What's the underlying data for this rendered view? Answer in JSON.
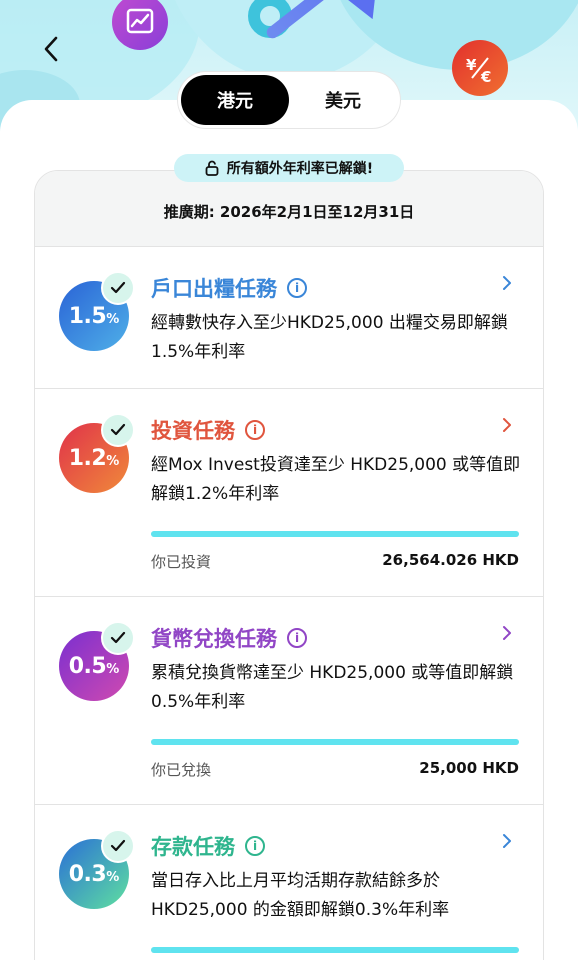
{
  "header": {
    "currency_tabs": [
      {
        "label": "港元",
        "active": true
      },
      {
        "label": "美元",
        "active": false
      }
    ]
  },
  "unlock_banner": "所有額外年利率已解鎖!",
  "promo_period": "推廣期: 2026年2月1日至12月31日",
  "tasks": [
    {
      "rate_number": "1.5",
      "rate_unit": "%",
      "title": "戶口出糧任務",
      "description": "經轉數快存入至少HKD25,000 出糧交易即解鎖1.5%年利率",
      "completed": true
    },
    {
      "rate_number": "1.2",
      "rate_unit": "%",
      "title": "投資任務",
      "description": "經Mox Invest投資達至少 HKD25,000 或等值即解鎖1.2%年利率",
      "completed": true,
      "progress": 1.0,
      "foot_label": "你已投資",
      "foot_value": "26,564.026 HKD"
    },
    {
      "rate_number": "0.5",
      "rate_unit": "%",
      "title": "貨幣兌換任務",
      "description": "累積兌換貨幣達至少 HKD25,000 或等值即解鎖0.5%年利率",
      "completed": true,
      "progress": 1.0,
      "foot_label": "你已兌換",
      "foot_value": "25,000 HKD"
    },
    {
      "rate_number": "0.3",
      "rate_unit": "%",
      "title": "存款任務",
      "description": "當日存入比上月平均活期存款結餘多於HKD25,000 的金額即解鎖0.3%年利率",
      "completed": true,
      "progress": 1.0
    }
  ],
  "icons": {
    "back": "chevron-left-icon",
    "lock": "unlock-icon",
    "info": "info-icon",
    "chevron": "chevron-right-icon",
    "check": "check-icon",
    "fx": "currency-exchange-icon",
    "chart": "trend-chart-icon"
  },
  "colors": {
    "task1": "#3a86d8",
    "task2": "#e0553e",
    "task3": "#9146c6",
    "task4": "#2fb58e",
    "progress_fill": "#5fe3ef",
    "active_tab": "#000000"
  }
}
